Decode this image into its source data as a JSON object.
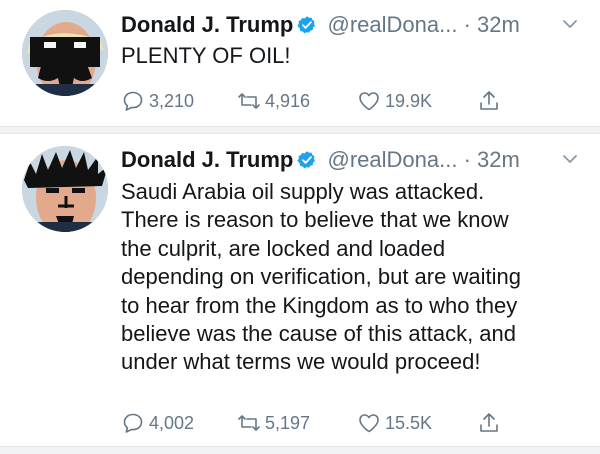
{
  "tweets": [
    {
      "name": "Donald J. Trump",
      "handle": "@realDona...",
      "dot": "·",
      "time": "32m",
      "text": "PLENTY OF OIL!",
      "replies": "3,210",
      "retweets": "4,916",
      "likes": "19.9K"
    },
    {
      "name": "Donald J. Trump",
      "handle": "@realDona...",
      "dot": "·",
      "time": "32m",
      "text": "Saudi Arabia oil supply was attacked.\nThere is reason to believe that we know\nthe culprit, are locked and loaded\ndepending on verification, but are waiting\nto hear from the Kingdom as to who they\nbelieve was the cause of this attack, and\nunder what terms we would proceed!",
      "replies": "4,002",
      "retweets": "5,197",
      "likes": "15.5K"
    }
  ],
  "icons": {
    "verified": "verified-badge-icon",
    "more": "chevron-down-icon",
    "reply": "reply-icon",
    "retweet": "retweet-icon",
    "like": "heart-icon",
    "share": "share-icon"
  },
  "colors": {
    "verified": "#1da1f2",
    "secondary_text": "#657786",
    "primary_text": "#14171a"
  }
}
